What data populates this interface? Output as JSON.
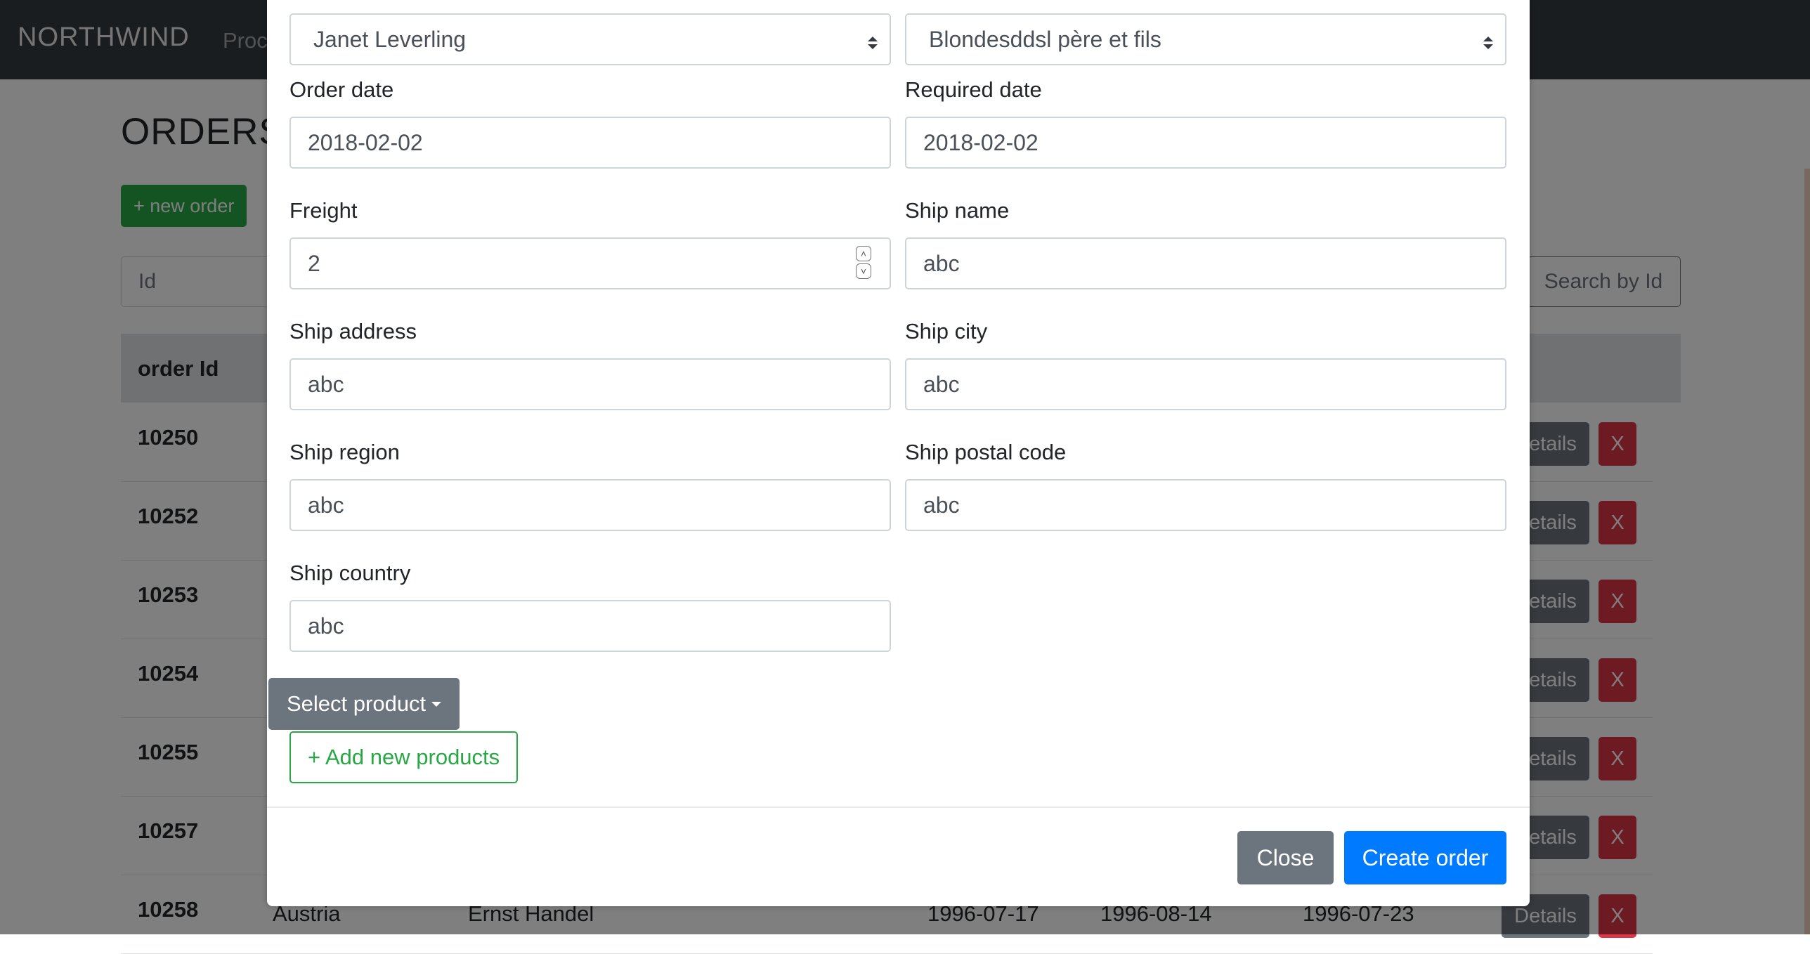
{
  "navbar": {
    "brand": "NORTHWIND",
    "link": "Proc"
  },
  "page": {
    "title": "ORDERS",
    "new_order_label": "+ new order",
    "search_placeholder": "Id",
    "search_button": "Search by Id"
  },
  "table": {
    "header_order_id": "order Id",
    "rows": [
      {
        "id": "10250",
        "country": "",
        "customer": "",
        "d1": "",
        "d2": "",
        "d3": ""
      },
      {
        "id": "10252",
        "country": "",
        "customer": "",
        "d1": "",
        "d2": "",
        "d3": ""
      },
      {
        "id": "10253",
        "country": "",
        "customer": "",
        "d1": "",
        "d2": "",
        "d3": ""
      },
      {
        "id": "10254",
        "country": "",
        "customer": "",
        "d1": "",
        "d2": "",
        "d3": ""
      },
      {
        "id": "10255",
        "country": "",
        "customer": "",
        "d1": "",
        "d2": "",
        "d3": ""
      },
      {
        "id": "10257",
        "country": "",
        "customer": "",
        "d1": "",
        "d2": "",
        "d3": ""
      },
      {
        "id": "10258",
        "country": "Austria",
        "customer": "Ernst Handel",
        "d1": "1996-07-17",
        "d2": "1996-08-14",
        "d3": "1996-07-23"
      }
    ],
    "details_label": "Details",
    "delete_label": "X"
  },
  "modal": {
    "employee": "Janet Leverling",
    "customer": "Blondesddsl père et fils",
    "order_date_label": "Order date",
    "order_date": "2018-02-02",
    "required_date_label": "Required date",
    "required_date": "2018-02-02",
    "freight_label": "Freight",
    "freight": "2",
    "ship_name_label": "Ship name",
    "ship_name": "abc",
    "ship_address_label": "Ship address",
    "ship_address": "abc",
    "ship_city_label": "Ship city",
    "ship_city": "abc",
    "ship_region_label": "Ship region",
    "ship_region": "abc",
    "ship_postal_code_label": "Ship postal code",
    "ship_postal_code": "abc",
    "ship_country_label": "Ship country",
    "ship_country": "abc",
    "select_product_label": "Select product",
    "add_products_label": "+ Add new products",
    "close_label": "Close",
    "create_label": "Create order"
  },
  "colors": {
    "primary": "#007bff",
    "success": "#28a745",
    "secondary": "#6c757d",
    "danger": "#dc3545",
    "navbar": "#343a40"
  }
}
